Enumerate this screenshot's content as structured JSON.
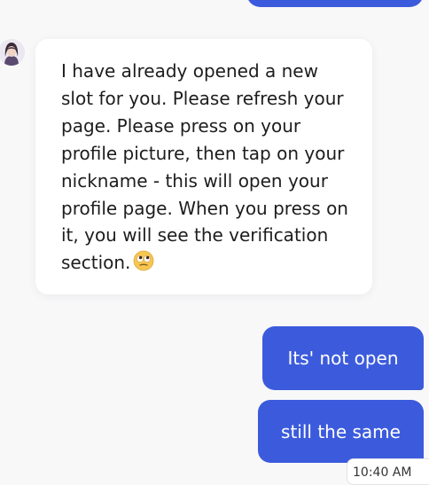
{
  "agent_message": {
    "text": "I have already opened a new slot for you. Please refresh your page. Please press on your profile picture, then tap on your nickname - this will open your profile page. When you press on it, you will see the verification section.",
    "emoji": "face-with-rolling-eyes-emoji",
    "avatar_icon": "agent-avatar-icon"
  },
  "user_messages": [
    {
      "text": "Its' not open"
    },
    {
      "text": "still the same"
    }
  ],
  "timestamp": "10:40 AM",
  "colors": {
    "user_bubble": "#3c5bdc",
    "agent_bubble": "#ffffff",
    "background": "#f8f8f9"
  }
}
